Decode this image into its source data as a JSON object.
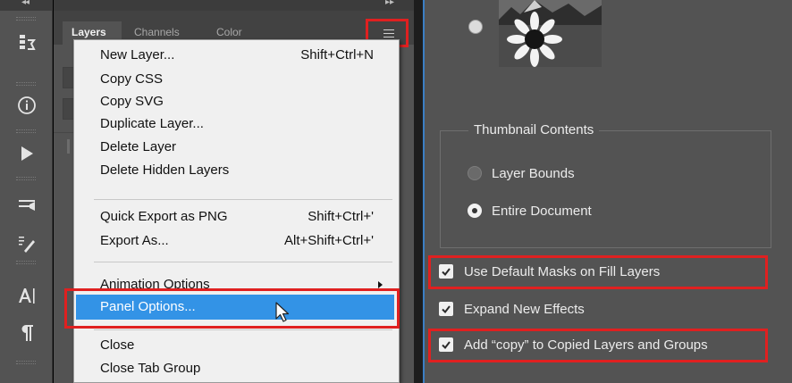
{
  "panel": {
    "tabs": [
      "Layers",
      "Channels",
      "Color"
    ]
  },
  "menu": {
    "items": [
      {
        "label": "New Layer...",
        "shortcut": "Shift+Ctrl+N"
      },
      {
        "label": "Copy CSS",
        "shortcut": ""
      },
      {
        "label": "Copy SVG",
        "shortcut": ""
      },
      {
        "label": "Duplicate Layer...",
        "shortcut": ""
      },
      {
        "label": "Delete Layer",
        "shortcut": ""
      },
      {
        "label": "Delete Hidden Layers",
        "shortcut": ""
      },
      {
        "label": "Quick Export as PNG",
        "shortcut": "Shift+Ctrl+'"
      },
      {
        "label": "Export As...",
        "shortcut": "Alt+Shift+Ctrl+'"
      },
      {
        "label": "Animation Options",
        "shortcut": ""
      },
      {
        "label": "Panel Options...",
        "shortcut": ""
      },
      {
        "label": "Close",
        "shortcut": ""
      },
      {
        "label": "Close Tab Group",
        "shortcut": ""
      }
    ],
    "highlighted": "Panel Options..."
  },
  "dialog": {
    "thumbnail_contents_title": "Thumbnail Contents",
    "radio_layer_bounds": "Layer Bounds",
    "radio_entire_document": "Entire Document",
    "selected_radio": "Entire Document",
    "checkbox_default_masks": "Use Default Masks on Fill Layers",
    "checkbox_expand_effects": "Expand New Effects",
    "checkbox_add_copy": "Add “copy” to Copied Layers and Groups",
    "checkbox_default_masks_checked": true,
    "checkbox_expand_effects_checked": true,
    "checkbox_add_copy_checked": true
  },
  "colors": {
    "highlight": "#3393e6",
    "annotation_red": "#e02020",
    "panel_bg": "#535353"
  }
}
